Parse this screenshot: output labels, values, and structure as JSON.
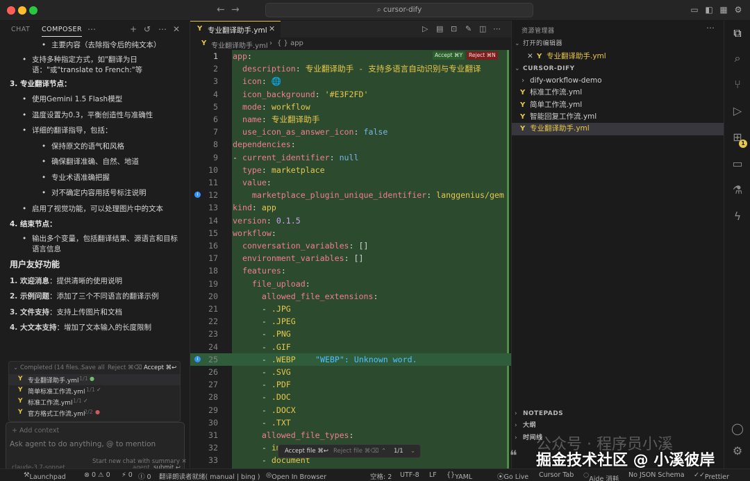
{
  "window": {
    "title": "cursor-dify"
  },
  "composer": {
    "tab_chat": "CHAT",
    "tab_composer": "COMPOSER",
    "lines": [
      {
        "text": "主要内容（去除指令后的纯文本）",
        "level": 2
      },
      {
        "text": "支持多种指定方式，如\"翻译为日语：\"或\"translate to French:\"等",
        "level": 1
      },
      {
        "text": "3. 专业翻译节点：",
        "level": 0,
        "head": "3. 专业翻译节点",
        "rest": "："
      },
      {
        "text": "使用Gemini 1.5 Flash模型",
        "level": 1
      },
      {
        "text": "温度设置为0.3，平衡创造性与准确性",
        "level": 1
      },
      {
        "text": "详细的翻译指导，包括：",
        "level": 1
      },
      {
        "text": "保持原文的语气和风格",
        "level": 2
      },
      {
        "text": "确保翻译准确、自然、地道",
        "level": 2
      },
      {
        "text": "专业术语准确把握",
        "level": 2
      },
      {
        "text": "对不确定内容用括号标注说明",
        "level": 2
      },
      {
        "text": "启用了视觉功能，可以处理图片中的文本",
        "level": 1
      },
      {
        "text": "4. 结束节点：",
        "level": 0
      },
      {
        "text": "输出多个变量，包括翻译结果、源语言和目标语言信息",
        "level": 1
      }
    ],
    "friendly_heading": "用户友好功能",
    "friendly": [
      {
        "head": "1. 欢迎消息",
        "rest": "：提供清晰的使用说明"
      },
      {
        "head": "2. 示例问题",
        "rest": "：添加了三个不同语言的翻译示例"
      },
      {
        "head": "3. 文件支持",
        "rest": "：支持上传图片和文档"
      },
      {
        "head": "4. 大文本支持",
        "rest": "：增加了文本输入的长度限制"
      }
    ],
    "completed": {
      "label": "Completed (14 files...",
      "save_all": "Save all",
      "reject": "Reject ⌘⌫",
      "accept": "Accept ⌘↩",
      "files": [
        {
          "name": "专业翻译助手.yml",
          "meta": "1/1",
          "mark": "●"
        },
        {
          "name": "简单标准工作流.yml",
          "meta": "1/1",
          "mark": "✓"
        },
        {
          "name": "标准工作流.yml",
          "meta": "1/1",
          "mark": "✓"
        },
        {
          "name": "官方格式工作流.yml",
          "meta": "2/2",
          "mark": "●"
        }
      ]
    },
    "input": {
      "add_context": "+ Add context",
      "placeholder": "Ask agent to do anything, @ to mention",
      "model": "claude-3.7-sonnet",
      "mode": "agent",
      "submit": "submit ↩"
    },
    "new_chat": "Start new chat with summary"
  },
  "editor": {
    "tab": "专业翻译助手.yml",
    "breadcrumb_file": "专业翻译助手.yml",
    "breadcrumb_path": "{ } app",
    "accept_top": "Accept ⌘Y",
    "reject_top": "Reject ⌘N",
    "lines": [
      {
        "n": "1",
        "t": "app:"
      },
      {
        "n": "2",
        "t": "  description: 专业翻译助手 - 支持多语言自动识别与专业翻译"
      },
      {
        "n": "3",
        "t": "  icon: 🌐"
      },
      {
        "n": "4",
        "t": "  icon_background: '#E3F2FD'"
      },
      {
        "n": "5",
        "t": "  mode: workflow"
      },
      {
        "n": "6",
        "t": "  name: 专业翻译助手"
      },
      {
        "n": "7",
        "t": "  use_icon_as_answer_icon: false"
      },
      {
        "n": "8",
        "t": "dependencies:"
      },
      {
        "n": "9",
        "t": "- current_identifier: null"
      },
      {
        "n": "10",
        "t": "  type: marketplace"
      },
      {
        "n": "11",
        "t": "  value:"
      },
      {
        "n": "12",
        "t": "    marketplace_plugin_unique_identifier: langgenius/gem"
      },
      {
        "n": "13",
        "t": "kind: app"
      },
      {
        "n": "14",
        "t": "version: 0.1.5"
      },
      {
        "n": "15",
        "t": "workflow:"
      },
      {
        "n": "16",
        "t": "  conversation_variables: []"
      },
      {
        "n": "17",
        "t": "  environment_variables: []"
      },
      {
        "n": "18",
        "t": "  features:"
      },
      {
        "n": "19",
        "t": "    file_upload:"
      },
      {
        "n": "20",
        "t": "      allowed_file_extensions:"
      },
      {
        "n": "21",
        "t": "      - .JPG"
      },
      {
        "n": "22",
        "t": "      - .JPEG"
      },
      {
        "n": "23",
        "t": "      - .PNG"
      },
      {
        "n": "24",
        "t": "      - .GIF"
      },
      {
        "n": "25",
        "t": "      - .WEBP"
      },
      {
        "n": "26",
        "t": "      - .SVG"
      },
      {
        "n": "27",
        "t": "      - .PDF"
      },
      {
        "n": "28",
        "t": "      - .DOC"
      },
      {
        "n": "29",
        "t": "      - .DOCX"
      },
      {
        "n": "30",
        "t": "      - .TXT"
      },
      {
        "n": "31",
        "t": "      allowed_file_types:"
      },
      {
        "n": "32",
        "t": "      - im"
      },
      {
        "n": "33",
        "t": "      - document"
      }
    ],
    "diagnostic": "\"WEBP\": Unknown word.",
    "float_bar": {
      "accept_file": "Accept file ⌘↩",
      "reject_file": "Reject file ⌘⌫",
      "counter": "1/1"
    }
  },
  "explorer": {
    "title": "资源管理器",
    "open_editors": "打开的编辑器",
    "open_file": "专业翻译助手.yml",
    "workspace": "CURSOR-DIFY",
    "items": [
      {
        "name": "dify-workflow-demo",
        "kind": "folder"
      },
      {
        "name": "标准工作流.yml",
        "kind": "file"
      },
      {
        "name": "简单工作流.yml",
        "kind": "file"
      },
      {
        "name": "智能回复工作流.yml",
        "kind": "file"
      },
      {
        "name": "专业翻译助手.yml",
        "kind": "file"
      }
    ],
    "notepads": "NOTEPADS",
    "outline": "大纲",
    "timeline": "时间线",
    "badge_count": "1"
  },
  "statusbar": {
    "launchpad": "Launchpad",
    "problems": "⊗ 0 ⚠ 0",
    "info": "⚡ 0",
    "ports": "Ⓘ 0",
    "translate": "翻译朗读者就绪( manual | bing )",
    "open_browser": "Open In Browser",
    "spaces": "空格: 2",
    "encoding": "UTF-8",
    "eol": "LF",
    "language": "YAML",
    "golive": "Go Live",
    "cursor_tab": "Cursor Tab",
    "aide": "Aide 消耗",
    "schema": "No JSON Schema",
    "prettier": "Prettier"
  },
  "watermark": {
    "line1": "公众号 · 程序员小溪",
    "line2": "掘金技术社区 @ 小溪彼岸"
  }
}
